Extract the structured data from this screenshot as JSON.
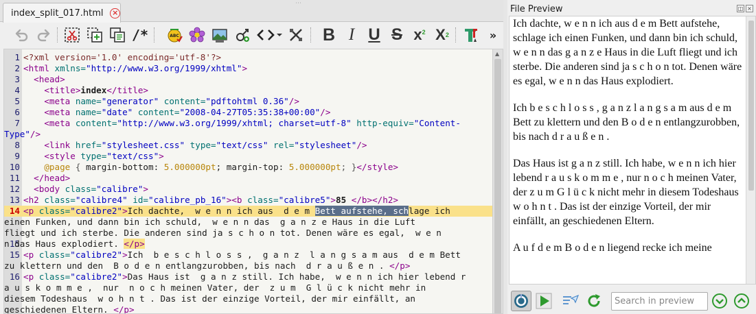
{
  "tab": {
    "title": "index_split_017.html"
  },
  "toolbar": {
    "icons": [
      "undo-icon",
      "redo-icon",
      "cut-icon",
      "copy-icon",
      "paste-icon",
      "comment-icon",
      "spellcheck-icon",
      "special-characters-icon",
      "insert-image-icon",
      "insert-link-icon",
      "code-tags-icon",
      "remove-formatting-icon",
      "bold-icon",
      "italic-icon",
      "underline-icon",
      "strikethrough-icon",
      "superscript-icon",
      "subscript-icon",
      "text-color-icon",
      "more-icon"
    ],
    "comment_label": "/*",
    "bold_label": "B",
    "italic_label": "I",
    "underline_label": "U",
    "strike_label": "S",
    "sup_label": "x",
    "sub_label": "X",
    "overflow_label": "»"
  },
  "editor": {
    "current_line": "14",
    "line_numbers": [
      "1",
      "2",
      "3",
      "4",
      "5",
      "6",
      "7",
      "",
      "8",
      "9",
      "10",
      "11",
      "12",
      "13",
      "14",
      "",
      "",
      "15",
      "",
      "16",
      "",
      "",
      ""
    ],
    "code": {
      "l1": "<?xml version='1.0' encoding='utf-8'?>",
      "l2_tag": "<html",
      "l2_attr": " xmlns=",
      "l2_val": "\"http://www.w3.org/1999/xhtml\"",
      "l2_end": ">",
      "l3": "<head>",
      "l4_open": "<title>",
      "l4_text": "index",
      "l4_close": "</title>",
      "l5_tag": "<meta",
      "l5_a1": " name=",
      "l5_v1": "\"generator\"",
      "l5_a2": " content=",
      "l5_v2": "\"pdftohtml 0.36\"",
      "l5_end": "/>",
      "l6_tag": "<meta",
      "l6_a1": " name=",
      "l6_v1": "\"date\"",
      "l6_a2": " content=",
      "l6_v2": "\"2008-04-27T05:35:38+00:00\"",
      "l6_end": "/>",
      "l7_tag": "<meta",
      "l7_a1": " content=",
      "l7_v1": "\"http://www.w3.org/1999/xhtml; charset=utf-8\"",
      "l7_a2": " http-equiv=",
      "l7_v2": "\"Content-",
      "l7b_v": "Type\"",
      "l7b_end": "/>",
      "l8_tag": "<link",
      "l8_a1": " href=",
      "l8_v1": "\"stylesheet.css\"",
      "l8_a2": " type=",
      "l8_v2": "\"text/css\"",
      "l8_a3": " rel=",
      "l8_v3": "\"stylesheet\"",
      "l8_end": "/>",
      "l9_tag": "<style",
      "l9_a1": " type=",
      "l9_v1": "\"text/css\"",
      "l9_end": ">",
      "l10_at": "@page",
      "l10_brace": " { ",
      "l10_p1": "margin-bottom",
      "l10_c1": ": ",
      "l10_n1": "5.000000pt",
      "l10_s1": "; ",
      "l10_p2": "margin-top",
      "l10_c2": ": ",
      "l10_n2": "5.000000pt",
      "l10_s2": "; }",
      "l10_close": "</style>",
      "l11": "</head>",
      "l12_tag": "<body",
      "l12_a1": " class=",
      "l12_v1": "\"calibre\"",
      "l12_end": ">",
      "l13_tag": "<h2",
      "l13_a1": " class=",
      "l13_v1": "\"calibre4\"",
      "l13_a2": " id=",
      "l13_v2": "\"calibre_pb_16\"",
      "l13_end": ">",
      "l13_btag": "<b",
      "l13_a3": " class=",
      "l13_v3": "\"calibre5\"",
      "l13_bend": ">",
      "l13_text": "85 ",
      "l13_close": "</b></h2>",
      "l14_tag": "<p",
      "l14_a1": " class=",
      "l14_v1": "\"calibre2\"",
      "l14_end": ">",
      "l14_pre": "Ich dachte,  w e n n ich aus  d e m ",
      "l14_sel": "Bett aufstehe, sch",
      "l14_post": "lage ich",
      "l14b": "einen Funken, und dann bin ich schuld,  w e n n das  g a n z e Haus in die Luft",
      "l14c_text": "fliegt und ich sterbe. Die anderen sind ja s c h o n tot. Denen wäre es egal,  w e n",
      "l14d_text": "n das Haus explodiert. ",
      "l14d_close": "</p>",
      "l15_tag": "<p",
      "l15_a1": " class=",
      "l15_v1": "\"calibre2\"",
      "l15_end": ">",
      "l15_text": "Ich  b e s c h l o s s ,  g a n z  l a n g s a m aus  d e m Bett",
      "l15b_text": "zu klettern und den  B o d e n entlangzurobben, bis nach  d r a u ß e n . ",
      "l15b_close": "</p>",
      "l16_tag": "<p",
      "l16_a1": " class=",
      "l16_v1": "\"calibre2\"",
      "l16_end": ">",
      "l16_text": "Das Haus ist  g a n z still. Ich habe,  w e n n ich hier lebend r",
      "l16b": "a u s k o m m e ,  nur  n o c h meinen Vater, der  z u m  G l ü c k nicht mehr in",
      "l16c": "diesem Todeshaus  w o h n t . Das ist der einzige Vorteil, der mir einfällt, an",
      "l16d_text": "geschiedenen Eltern. ",
      "l16d_close": "</p>"
    }
  },
  "preview": {
    "title": "File Preview",
    "paragraphs": [
      "Ich dachte, w e n n ich aus d e m Bett aufstehe, schlage ich einen Funken, und dann bin ich schuld, w e n n das g a n z e Haus in die Luft fliegt und ich sterbe. Die anderen sind ja s c h o n tot. Denen wäre es egal, w e n n das Haus explodiert.",
      "Ich b e s c h l o s s , g a n z l a n g s a m aus d e m Bett zu klettern und den B o d e n entlangzurobben, bis nach d r a u ß e n .",
      "Das Haus ist g a n z still. Ich habe, w e n n ich hier lebend r a u s k o m m e , nur n o c h meinen Vater, der z u m G l ü c k nicht mehr in diesem Todeshaus w o h n t . Das ist der einzige Vorteil, der mir einfällt, an geschiedenen Eltern.",
      "A u f d e m B o d e n liegend recke ich meine"
    ],
    "search_placeholder": "Search in preview",
    "buttons": [
      "sync-icon",
      "play-icon",
      "inspect-icon",
      "reload-icon",
      "search-next-icon",
      "search-previous-icon"
    ]
  },
  "colors": {
    "current_line": "#fae18a",
    "tag": "#8b008b",
    "attr": "#007070",
    "value": "#0000c0",
    "selection": "#5a6e8a",
    "accent_green": "#2e9a2e"
  }
}
